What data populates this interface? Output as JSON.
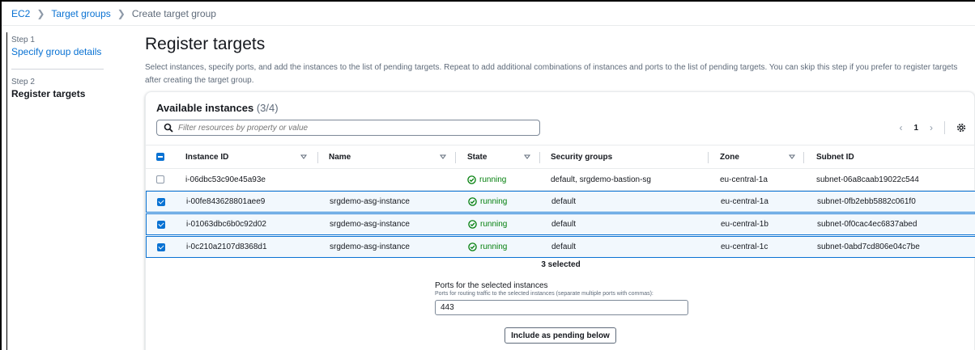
{
  "breadcrumb": {
    "items": [
      "EC2",
      "Target groups"
    ],
    "current": "Create target group"
  },
  "steps": [
    {
      "number": "Step 1",
      "label": "Specify group details"
    },
    {
      "number": "Step 2",
      "label": "Register targets"
    }
  ],
  "page": {
    "title": "Register targets",
    "description": "Select instances, specify ports, and add the instances to the list of pending targets. Repeat to add additional combinations of instances and ports to the list of pending targets. You can skip this step if you prefer to register targets after creating the target group."
  },
  "instances": {
    "title": "Available instances",
    "count": "(3/4)",
    "filter_placeholder": "Filter resources by property or value",
    "page_number": "1",
    "columns": [
      "Instance ID",
      "Name",
      "State",
      "Security groups",
      "Zone",
      "Subnet ID"
    ],
    "rows": [
      {
        "selected": false,
        "id": "i-06dbc53c90e45a93e",
        "name": "",
        "state": "running",
        "sg": "default, srgdemo-bastion-sg",
        "zone": "eu-central-1a",
        "subnet": "subnet-06a8caab19022c544"
      },
      {
        "selected": true,
        "id": "i-00fe843628801aee9",
        "name": "srgdemo-asg-instance",
        "state": "running",
        "sg": "default",
        "zone": "eu-central-1a",
        "subnet": "subnet-0fb2ebb5882c061f0"
      },
      {
        "selected": true,
        "id": "i-01063dbc6b0c92d02",
        "name": "srgdemo-asg-instance",
        "state": "running",
        "sg": "default",
        "zone": "eu-central-1b",
        "subnet": "subnet-0f0cac4ec6837abed"
      },
      {
        "selected": true,
        "id": "i-0c210a2107d8368d1",
        "name": "srgdemo-asg-instance",
        "state": "running",
        "sg": "default",
        "zone": "eu-central-1c",
        "subnet": "subnet-0abd7cd806e04c7be"
      }
    ],
    "selected_count": "3 selected"
  },
  "ports": {
    "label": "Ports for the selected instances",
    "hint": "Ports for routing traffic to the selected instances (separate multiple ports with commas):",
    "value": "443"
  },
  "include_button": "Include as pending below",
  "colors": {
    "link": "#0972d3",
    "running": "#037f0c",
    "selected_row_bg": "#f2f8fd"
  }
}
